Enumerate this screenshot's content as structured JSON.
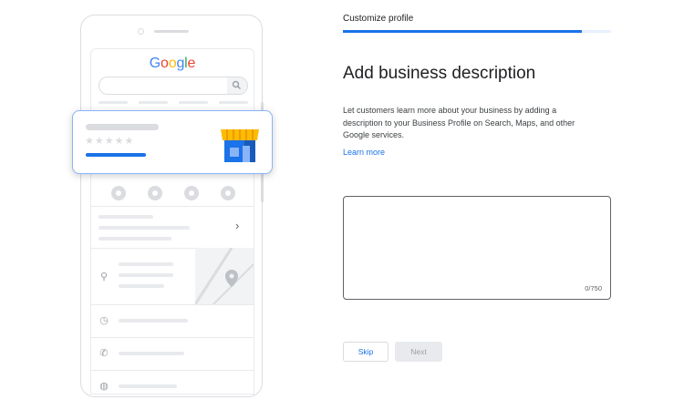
{
  "phone": {
    "logo_letters": [
      "G",
      "o",
      "o",
      "g",
      "l",
      "e"
    ],
    "stars": "★★★★★"
  },
  "form": {
    "step_title": "Customize profile",
    "progress_fraction": 0.89,
    "heading": "Add business description",
    "description": "Let customers learn more about your business by adding a description to your Business Profile on Search, Maps, and other Google services.",
    "learn_more": "Learn more",
    "textarea_value": "",
    "char_counter": "0/750",
    "skip_label": "Skip",
    "next_label": "Next"
  },
  "colors": {
    "accent": "#1a73e8",
    "card_border": "#8ab4f8",
    "disabled": "#e8eaed"
  }
}
